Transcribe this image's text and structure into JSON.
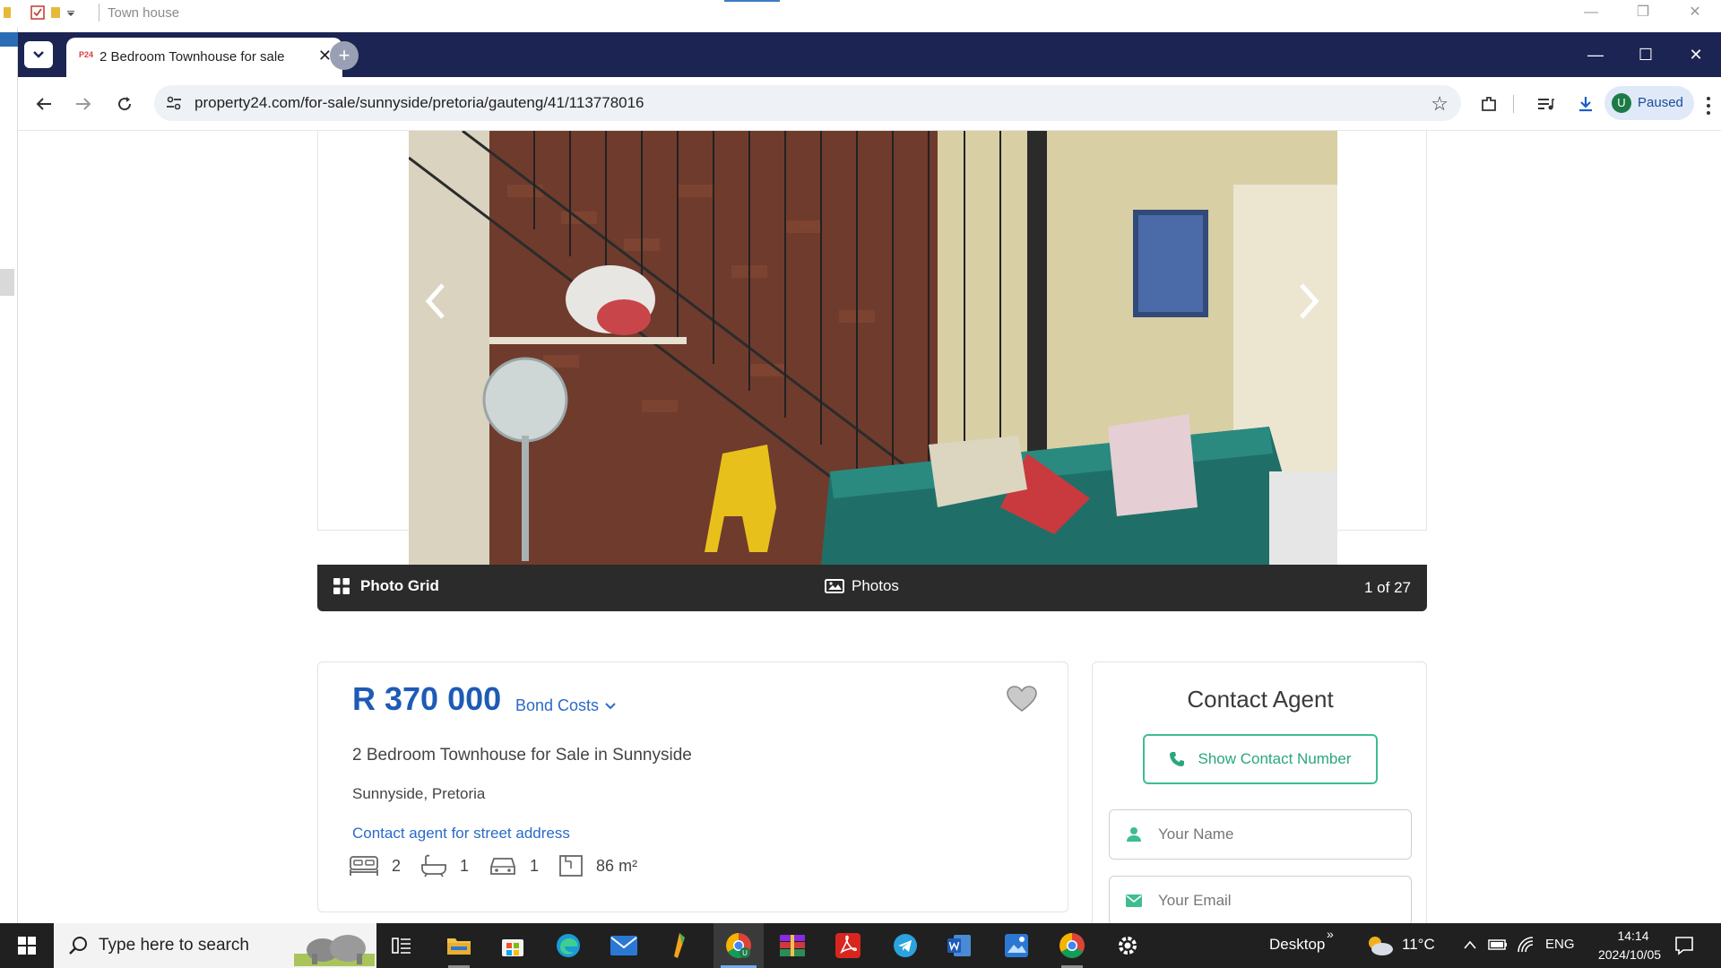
{
  "outer_window": {
    "title": "Town house",
    "controls": [
      "—",
      "❐",
      "✕"
    ]
  },
  "browser": {
    "tab": {
      "title": "2 Bedroom Townhouse for sale",
      "favicon_text": "P24"
    },
    "new_tab_symbol": "+",
    "url": "property24.com/for-sale/sunnyside/pretoria/gauteng/41/113778016",
    "profile": {
      "initial": "U",
      "status": "Paused"
    },
    "window_controls": [
      "—",
      "☐",
      "✕"
    ]
  },
  "gallery": {
    "photo_grid_label": "Photo Grid",
    "photos_label": "Photos",
    "counter": "1 of 27"
  },
  "listing": {
    "price": "R 370 000",
    "bond_costs_label": "Bond Costs",
    "title": "2 Bedroom Townhouse for Sale in Sunnyside",
    "location": "Sunnyside, Pretoria",
    "street_link": "Contact agent for street address",
    "features": {
      "bedrooms": "2",
      "bathrooms": "1",
      "parking": "1",
      "floor_size": "86 m²"
    }
  },
  "contact": {
    "title": "Contact Agent",
    "show_number_label": "Show Contact Number",
    "name_placeholder": "Your Name",
    "email_placeholder": "Your Email"
  },
  "taskbar": {
    "search_placeholder": "Type here to search",
    "desktop_label": "Desktop",
    "desktop_chevron": "»",
    "temperature": "11°C",
    "language": "ENG",
    "time": "14:14",
    "date": "2024/10/05"
  },
  "colors": {
    "price_blue": "#1d5bb5",
    "link_blue": "#2a6ac8",
    "contact_green": "#3ebd8f",
    "tabstrip_navy": "#1b2452"
  }
}
